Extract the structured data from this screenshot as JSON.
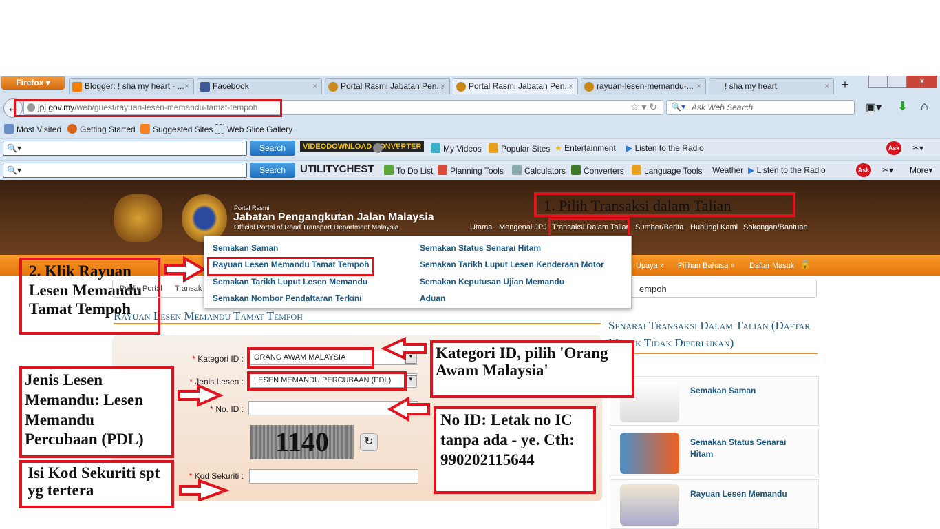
{
  "browser": {
    "menu_button": "Firefox",
    "tabs": [
      {
        "title": "Blogger: ! sha my heart - ...",
        "icon": "blogger-icon"
      },
      {
        "title": "Facebook",
        "icon": "facebook-icon"
      },
      {
        "title": "Portal Rasmi Jabatan Pen...",
        "icon": "jpj-icon"
      },
      {
        "title": "Portal Rasmi Jabatan Pen...",
        "icon": "jpj-icon",
        "active": true
      },
      {
        "title": "rayuan-lesen-memandu-...",
        "icon": "jpj-icon"
      },
      {
        "title": "! sha my heart",
        "icon": "none"
      }
    ],
    "url_domain": "jpj.gov.my",
    "url_path": "/web/guest/rayuan-lesen-memandu-tamat-tempoh",
    "search_placeholder": "Ask Web Search",
    "bookmarks": [
      "Most Visited",
      "Getting Started",
      "Suggested Sites",
      "Web Slice Gallery"
    ],
    "toolbar1": {
      "search": "Search",
      "logo": "VIDEODOWNLOAD CONVERTER",
      "items": [
        "Download",
        "My Videos",
        "Popular Sites",
        "Entertainment",
        "Listen to the Radio"
      ]
    },
    "toolbar2": {
      "search": "Search",
      "logo": "UTILITYCHEST",
      "items": [
        "To Do List",
        "Planning Tools",
        "Calculators",
        "Converters",
        "Language Tools",
        "Weather",
        "Listen to the Radio"
      ],
      "more": "More"
    }
  },
  "site": {
    "portal_small": "Portal Rasmi",
    "title": "Jabatan Pengangkutan Jalan Malaysia",
    "subtitle": "Official Portal of Road Transport Department Malaysia",
    "nav": [
      "Utama",
      "Mengenai JPJ",
      "Transaksi Dalam Talian",
      "Sumber/Berita",
      "Hubungi Kami",
      "Sokongan/Bantuan"
    ],
    "orange_nav": [
      "Upaya »",
      "Pilihan Bahasa »",
      "Daftar Masuk"
    ],
    "dropdown": {
      "left": [
        "Semakan Saman",
        "Rayuan Lesen Memandu Tamat Tempoh",
        "Semakan Tarikh Luput Lesen Memandu",
        "Semakan Nombor Pendaftaran Terkini"
      ],
      "right": [
        "Semakan Status Senarai Hitam",
        "Semakan Tarikh Luput Lesen Kenderaan Motor",
        "Semakan Keputusan Ujian Memandu",
        "Aduan"
      ]
    },
    "breadcrumb": [
      "Public Portal",
      "Transak",
      "empoh"
    ],
    "page_heading": "Rayuan Lesen Memandu Tamat Tempoh",
    "form": {
      "kategori_label": "Kategori ID :",
      "kategori_value": "ORANG AWAM MALAYSIA",
      "jenis_label": "Jenis Lesen :",
      "jenis_value": "LESEN MEMANDU PERCUBAAN (PDL)",
      "noid_label": "No. ID :",
      "noid_value": "",
      "captcha_text": "1140",
      "kod_label": "Kod Sekuriti :",
      "kod_value": "",
      "required_mark": "*"
    },
    "side_heading": "Senarai Transaksi Dalam Talian (Daftar Masuk Tidak Diperlukan)",
    "side_items": [
      "Semakan Saman",
      "Semakan Status Senarai Hitam",
      "Rayuan Lesen Memandu"
    ]
  },
  "annotations": {
    "a1": "1. Pilih Transaksi dalam Talian",
    "a2": "2. Klik Rayuan Lesen Memandu Tamat Tempoh",
    "a3": "Kategori ID, pilih 'Orang Awam Malaysia'",
    "a4": "Jenis Lesen Memandu: Lesen Memandu Percubaan (PDL)",
    "a5": "No ID: Letak no IC tanpa ada - ye. Cth: 990202115644",
    "a6": "Isi Kod Sekuriti spt yg tertera"
  },
  "colors": {
    "annotation": "#e0141e",
    "link": "#1b5a86",
    "orange": "#f08a1c",
    "header": "#4a2a14"
  }
}
